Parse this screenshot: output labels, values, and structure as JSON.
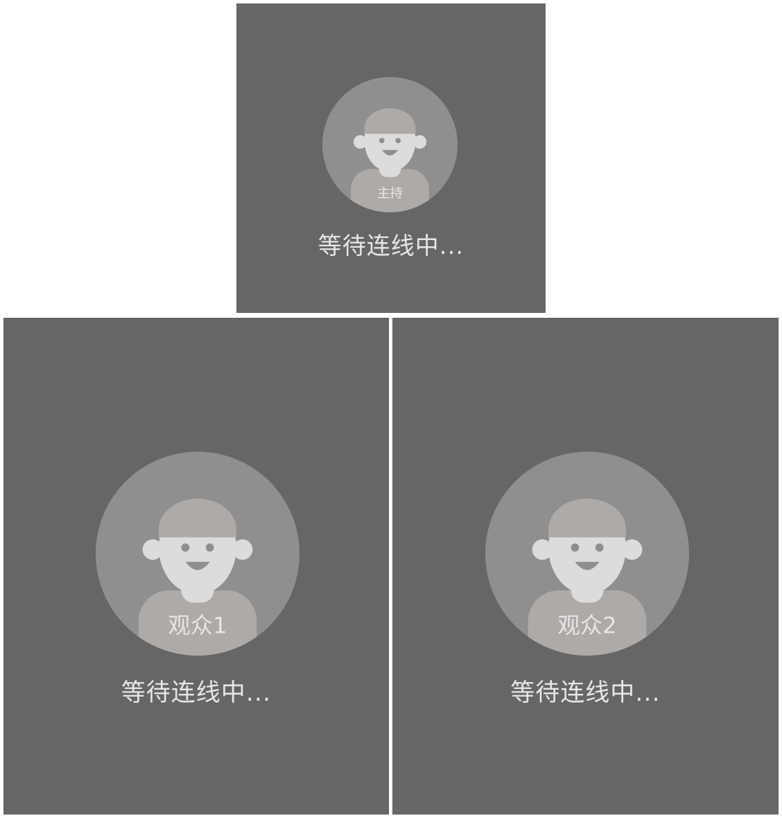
{
  "colors": {
    "tile_bg": "#666666",
    "avatar_circle": "#8f8f8f",
    "hair_body": "#aeaaa8",
    "skin": "#dcdcdc",
    "text": "#e6e6e6"
  },
  "tiles": [
    {
      "role_label": "主持",
      "status": "等待连线中..."
    },
    {
      "role_label": "观众1",
      "status": "等待连线中..."
    },
    {
      "role_label": "观众2",
      "status": "等待连线中..."
    }
  ]
}
